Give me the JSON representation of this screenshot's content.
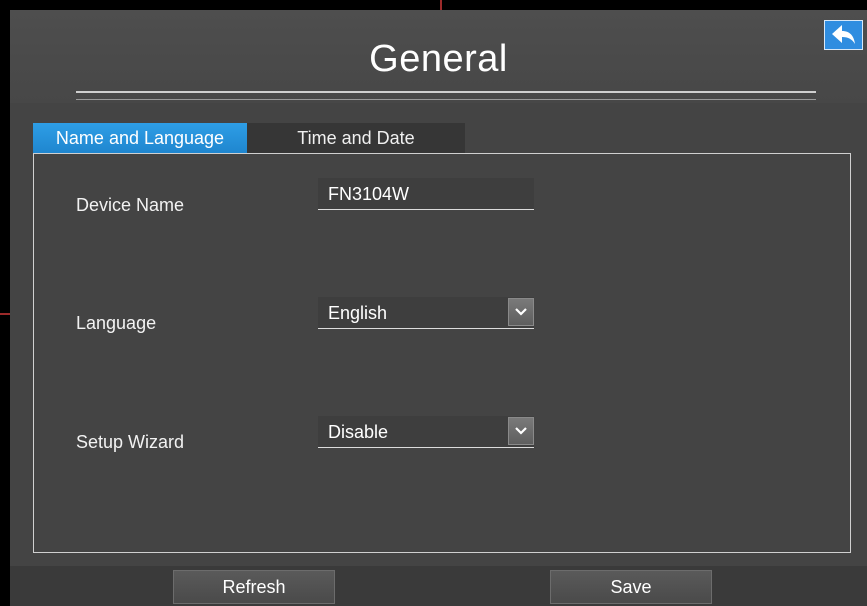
{
  "window": {
    "title": "General"
  },
  "tabs": [
    {
      "label": "Name and Language",
      "active": true
    },
    {
      "label": "Time and Date",
      "active": false
    }
  ],
  "form": {
    "device_name": {
      "label": "Device Name",
      "value": "FN3104W"
    },
    "language": {
      "label": "Language",
      "value": "English"
    },
    "setup_wizard": {
      "label": "Setup Wizard",
      "value": "Disable"
    }
  },
  "footer": {
    "refresh_label": "Refresh",
    "save_label": "Save"
  },
  "icons": {
    "back": "back-arrow-icon",
    "dropdown": "chevron-down-icon"
  },
  "colors": {
    "accent": "#2f8de0",
    "background": "#444444"
  }
}
